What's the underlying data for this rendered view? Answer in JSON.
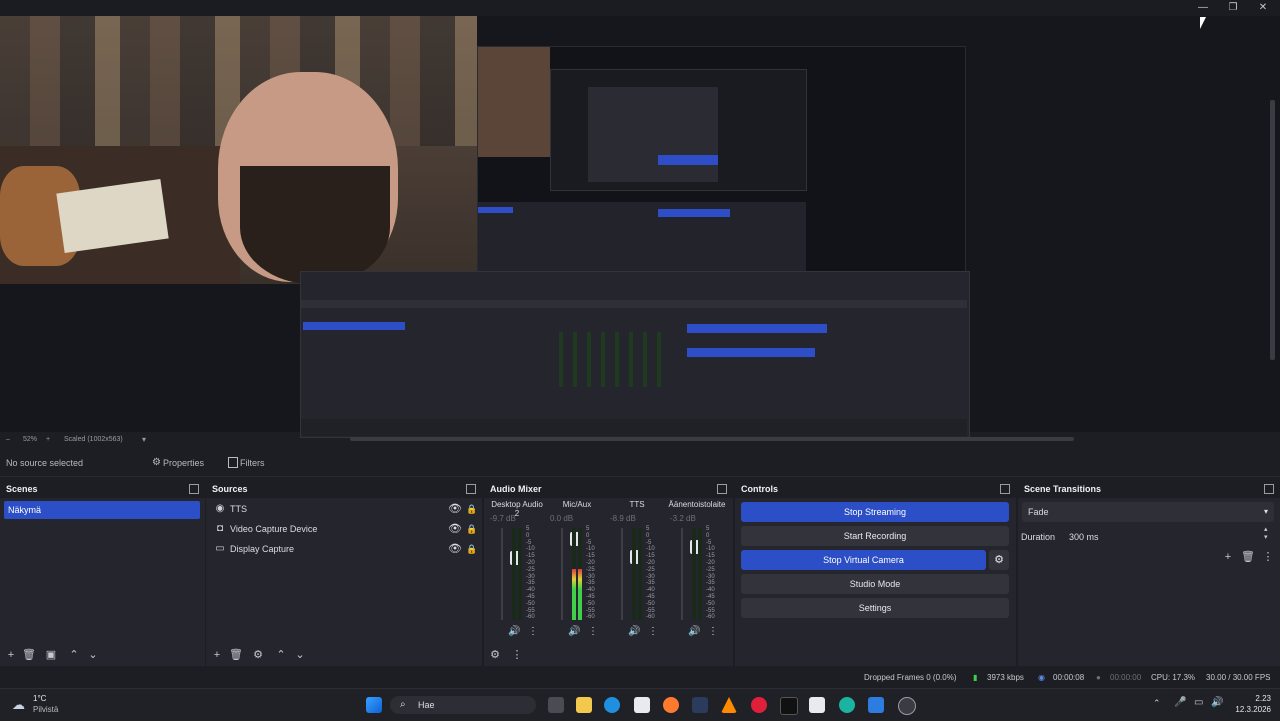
{
  "window": {
    "minimize": "—",
    "maximize": "❐",
    "close": "✕"
  },
  "zoom": {
    "level": "52%",
    "mode": "Scaled (1002x563)"
  },
  "context_bar": {
    "no_source": "No source selected",
    "properties": "Properties",
    "filters": "Filters"
  },
  "scenes": {
    "title": "Scenes",
    "items": [
      "Näkymä"
    ]
  },
  "sources": {
    "title": "Sources",
    "items": [
      {
        "label": "TTS",
        "icon": "tts-icon"
      },
      {
        "label": "Video Capture Device",
        "icon": "camera-icon"
      },
      {
        "label": "Display Capture",
        "icon": "monitor-icon"
      }
    ]
  },
  "mixer": {
    "title": "Audio Mixer",
    "channels": [
      {
        "name": "Desktop Audio 2",
        "db": "-9.7 dB",
        "level": 0.0,
        "fader": 0.7
      },
      {
        "name": "Mic/Aux",
        "db": "0.0 dB",
        "level": 0.55,
        "fader": 0.95
      },
      {
        "name": "TTS",
        "db": "-8.9 dB",
        "level": 0.0,
        "fader": 0.72
      },
      {
        "name": "Äänentoistolaite",
        "db": "-3.2 dB",
        "level": 0.0,
        "fader": 0.85
      }
    ],
    "scale": [
      "5",
      "0",
      "-5",
      "-10",
      "-15",
      "-20",
      "-25",
      "-30",
      "-35",
      "-40",
      "-45",
      "-50",
      "-55",
      "-60"
    ]
  },
  "controls": {
    "title": "Controls",
    "stop_streaming": "Stop Streaming",
    "start_recording": "Start Recording",
    "stop_virtual_camera": "Stop Virtual Camera",
    "studio_mode": "Studio Mode",
    "settings": "Settings"
  },
  "transitions": {
    "title": "Scene Transitions",
    "selected": "Fade",
    "duration_label": "Duration",
    "duration_value": "300 ms"
  },
  "status": {
    "dropped_frames": "Dropped Frames 0 (0.0%)",
    "bitrate": "3973 kbps",
    "stream_time": "00:00:08",
    "rec_time": "00:00:00",
    "cpu": "CPU: 17.3%",
    "fps": "30.00 / 30.00 FPS"
  },
  "taskbar": {
    "weather_temp": "1°C",
    "weather_place": "Pilvistä",
    "search": "Hae",
    "time": "2.23",
    "date": "12.3.2026"
  },
  "colors": {
    "accent": "#2c4ec6",
    "panel": "#25262d",
    "background": "#1d1e24"
  }
}
